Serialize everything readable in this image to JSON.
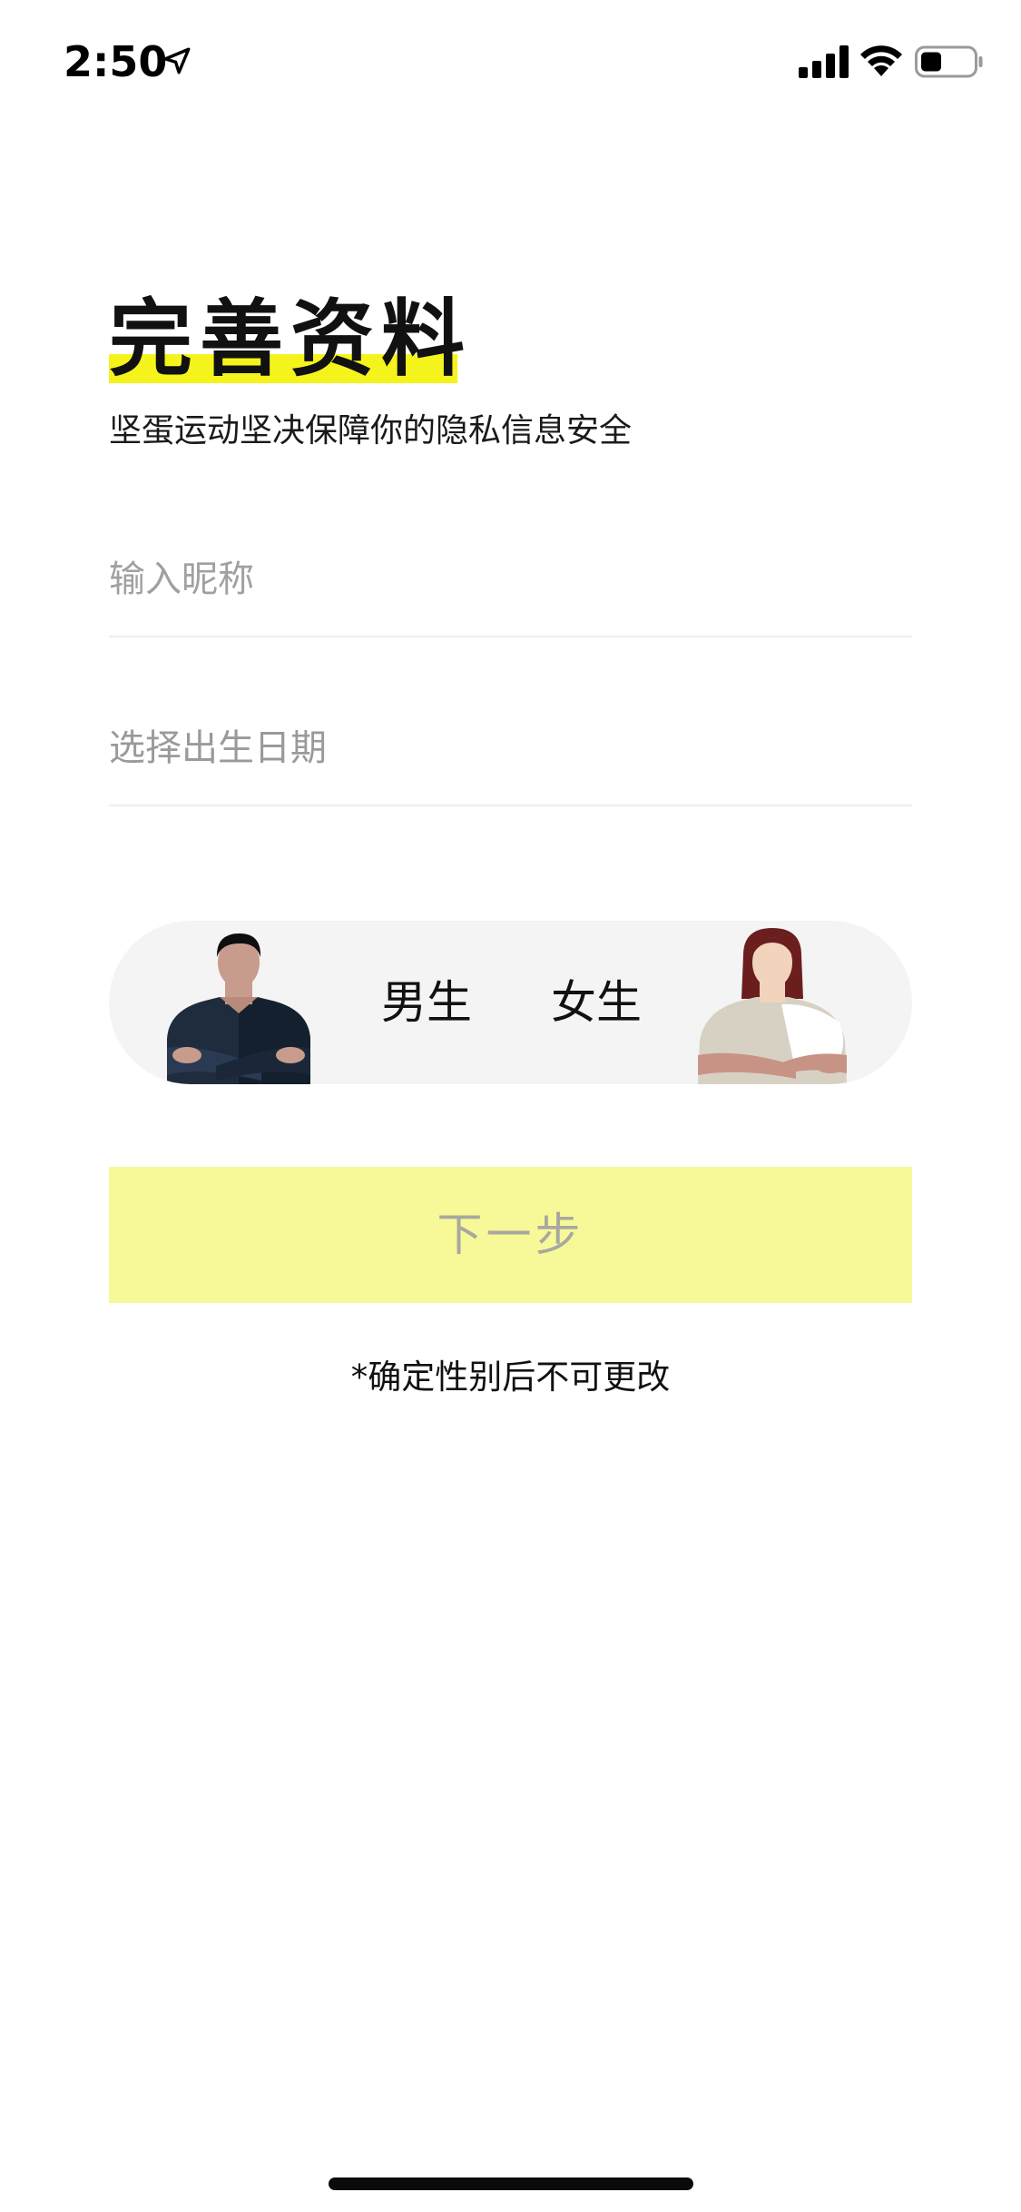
{
  "status_bar": {
    "time": "2:50",
    "icons": [
      "location-arrow-icon",
      "cellular-signal-icon",
      "wifi-icon",
      "battery-icon"
    ],
    "battery_level": 0.35
  },
  "header": {
    "title": "完善资料",
    "subtitle": "坚蛋运动坚决保障你的隐私信息安全",
    "highlight_color": "#f4f41c"
  },
  "form": {
    "nickname": {
      "value": "",
      "placeholder": "输入昵称"
    },
    "birthday": {
      "placeholder": "选择出生日期"
    }
  },
  "gender": {
    "male_label": "男生",
    "female_label": "女生",
    "selected": null
  },
  "actions": {
    "next_label": "下一步",
    "next_enabled": false,
    "next_color": "#f7f998"
  },
  "note": "*确定性别后不可更改"
}
